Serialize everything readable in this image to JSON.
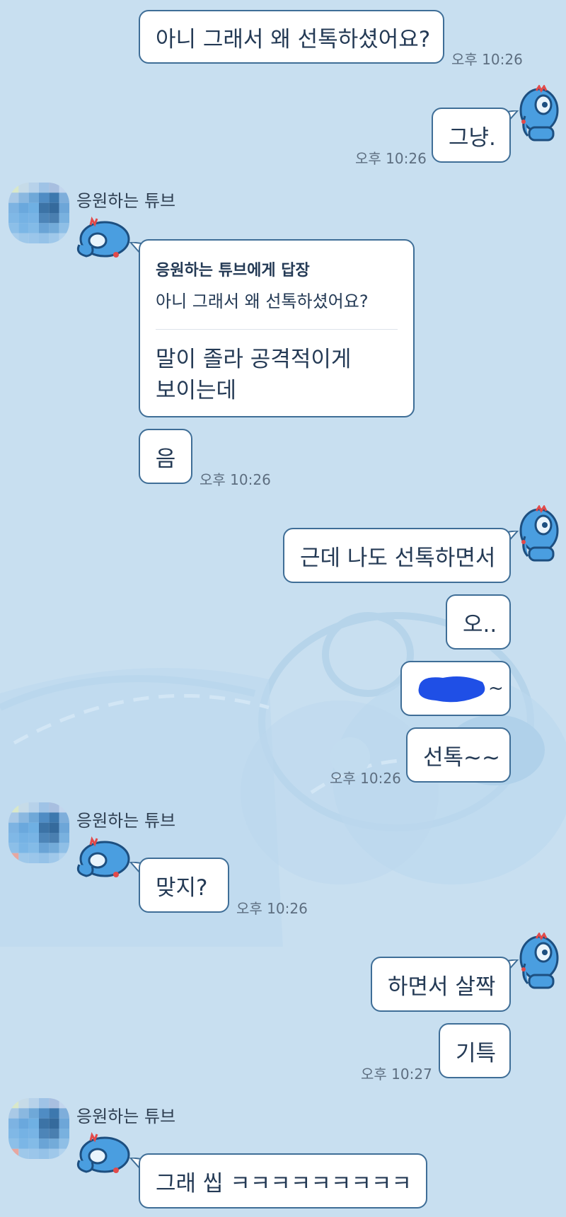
{
  "chat": {
    "contact_name": "응원하는 튜브",
    "messages": [
      {
        "text": "아니 그래서 왜 선톡하셨어요?",
        "time": "오후 10:26"
      },
      {
        "text": "그냥.",
        "time": "오후 10:26"
      },
      {
        "reply_header": "응원하는 튜브에게 답장",
        "reply_quote": "아니 그래서 왜 선톡하셨어요?",
        "text_line1": "말이 졸라 공격적이게",
        "text_line2": "보이는데"
      },
      {
        "text": "음",
        "time": "오후 10:26"
      },
      {
        "text": "근데 나도 선톡하면서"
      },
      {
        "text": "오.."
      },
      {
        "text": "~"
      },
      {
        "text": "선톡~~",
        "time": "오후 10:26"
      },
      {
        "text": "맞지?",
        "time": "오후 10:26"
      },
      {
        "text": "하면서 살짝"
      },
      {
        "text": "기특",
        "time": "오후 10:27"
      },
      {
        "text": "그래 씹 ㅋㅋㅋㅋㅋㅋㅋㅋㅋ"
      }
    ]
  },
  "colors": {
    "background": "#c8dff0",
    "bubble_border": "#3f6e97",
    "bubble_fill": "#ffffff",
    "redaction": "#1f4fe6",
    "mascot": "#4a9ee0"
  },
  "icons": {
    "contact_avatar": "pixelated-avatar",
    "profile_sticker": "blue-dog-mascot-icon"
  }
}
